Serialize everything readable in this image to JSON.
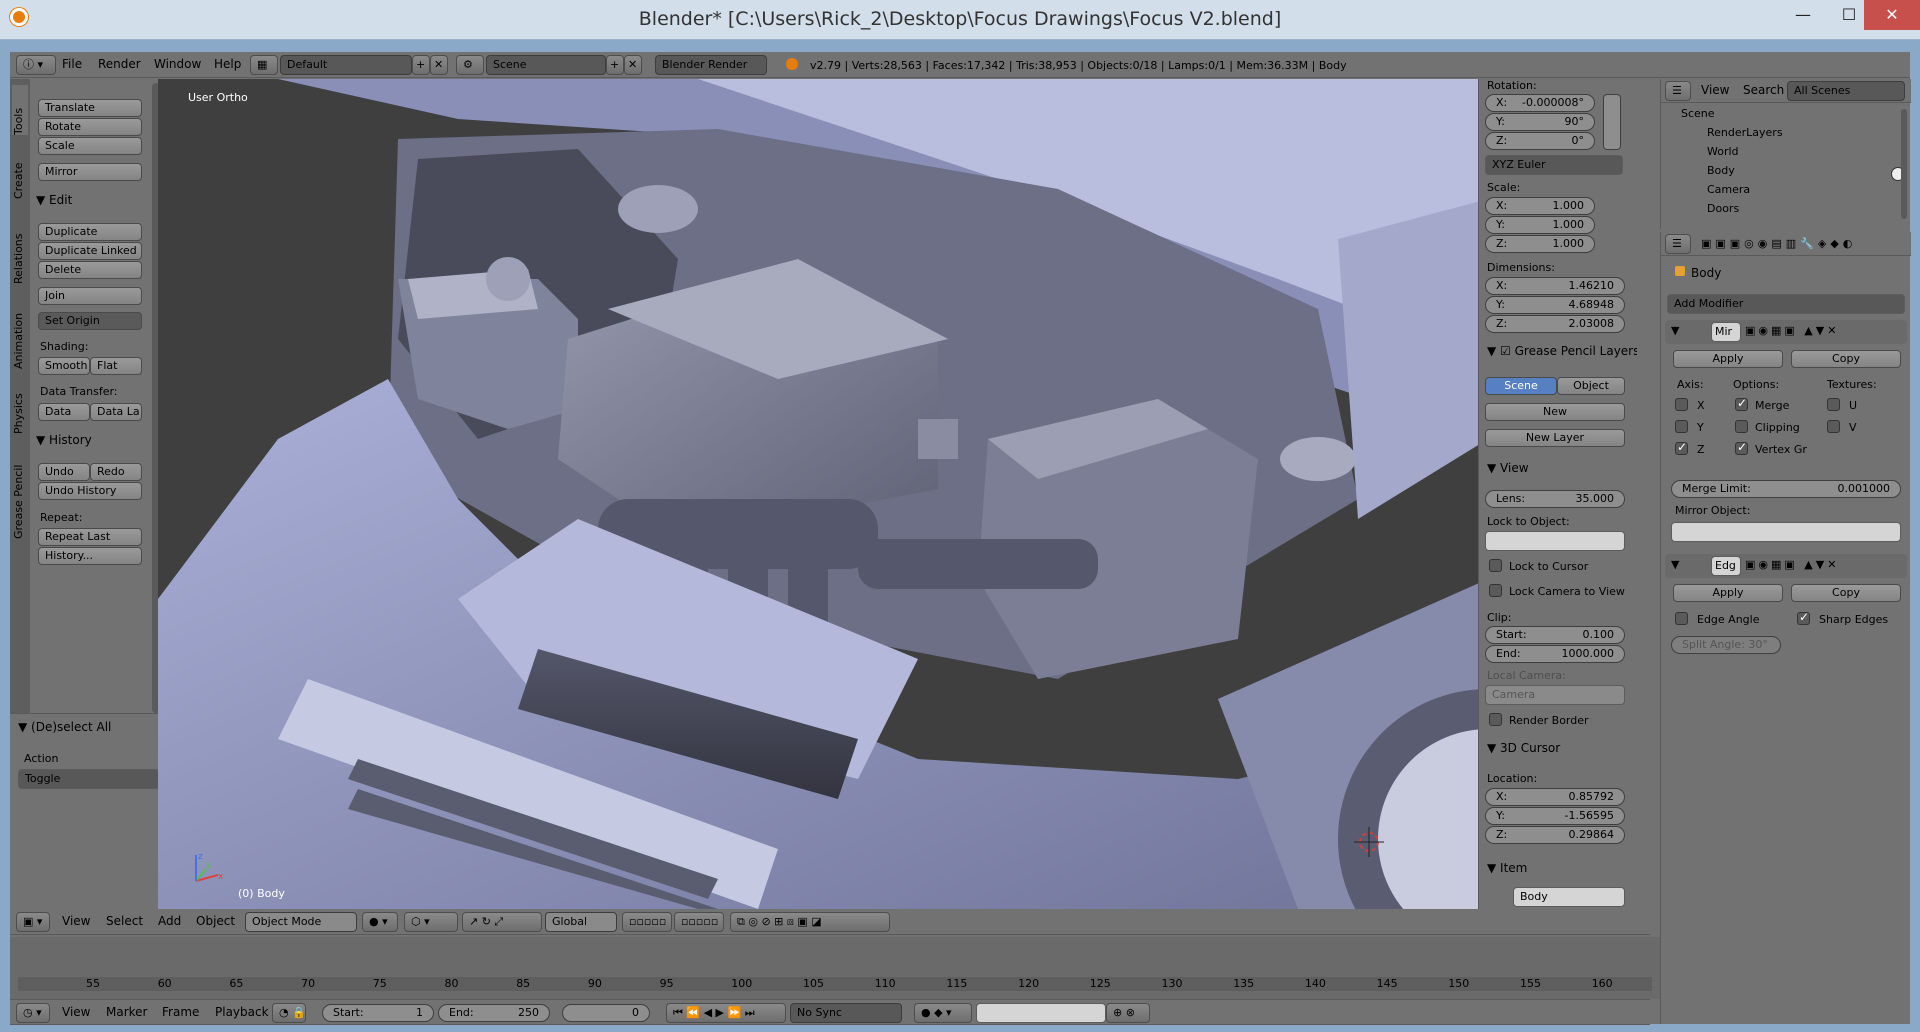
{
  "window": {
    "title": "Blender* [C:\\Users\\Rick_2\\Desktop\\Focus Drawings\\Focus V2.blend]",
    "min": "—",
    "max": "☐",
    "close": "✕"
  },
  "info_header": {
    "menus": [
      "File",
      "Render",
      "Window",
      "Help"
    ],
    "screen": "Default",
    "scene": "Scene",
    "engine": "Blender Render",
    "stats": "v2.79 | Verts:28,563 | Faces:17,342 | Tris:38,953 | Objects:0/18 | Lamps:0/1 | Mem:36.33M | Body"
  },
  "tool_tabs": [
    "Tools",
    "Create",
    "Relations",
    "Animation",
    "Physics",
    "Grease Pencil"
  ],
  "tools": {
    "translate": "Translate",
    "rotate": "Rotate",
    "scale": "Scale",
    "mirror": "Mirror",
    "edit_header": "Edit",
    "duplicate": "Duplicate",
    "duplicate_linked": "Duplicate Linked",
    "delete": "Delete",
    "join": "Join",
    "set_origin": "Set Origin",
    "shading_label": "Shading:",
    "smooth": "Smooth",
    "flat": "Flat",
    "data_transfer_label": "Data Transfer:",
    "data": "Data",
    "data_la": "Data La",
    "history_header": "History",
    "undo": "Undo",
    "redo": "Redo",
    "undo_history": "Undo History",
    "repeat_label": "Repeat:",
    "repeat_last": "Repeat Last",
    "history": "History..."
  },
  "operator": {
    "header": "(De)select All",
    "action_label": "Action",
    "action_value": "Toggle"
  },
  "viewport": {
    "view_label": "User Ortho",
    "object_label": "(0) Body"
  },
  "view3d_header": {
    "menus": [
      "View",
      "Select",
      "Add",
      "Object"
    ],
    "mode": "Object Mode",
    "orientation": "Global"
  },
  "properties_panel": {
    "rotation_label": "Rotation:",
    "rot_x": "-0.000008°",
    "rot_y": "90°",
    "rot_z": "0°",
    "rot_mode": "XYZ Euler",
    "scale_label": "Scale:",
    "scale_x": "1.000",
    "scale_y": "1.000",
    "scale_z": "1.000",
    "dimensions_label": "Dimensions:",
    "dim_x": "1.46210",
    "dim_y": "4.68948",
    "dim_z": "2.03008",
    "gp_header": "Grease Pencil Layers",
    "gp_scene": "Scene",
    "gp_object": "Object",
    "gp_new": "New",
    "gp_new_layer": "New Layer",
    "view_header": "View",
    "lens_label": "Lens:",
    "lens_value": "35.000",
    "lock_to_object": "Lock to Object:",
    "lock_to_cursor": "Lock to Cursor",
    "lock_camera": "Lock Camera to View",
    "clip_label": "Clip:",
    "clip_start_label": "Start:",
    "clip_start": "0.100",
    "clip_end_label": "End:",
    "clip_end": "1000.000",
    "local_camera": "Local Camera:",
    "camera": "Camera",
    "render_border": "Render Border",
    "cursor_header": "3D Cursor",
    "location_label": "Location:",
    "loc_x": "0.85792",
    "loc_y": "-1.56595",
    "loc_z": "0.29864",
    "item_header": "Item",
    "item_name": "Body"
  },
  "outliner": {
    "menus": [
      "View",
      "Search"
    ],
    "filter": "All Scenes",
    "items": [
      "Scene",
      "RenderLayers",
      "World",
      "Body",
      "Camera",
      "Doors"
    ]
  },
  "modifiers": {
    "object": "Body",
    "add_modifier": "Add Modifier",
    "mod1": {
      "name": "Mir",
      "apply": "Apply",
      "copy": "Copy",
      "axis_label": "Axis:",
      "options_label": "Options:",
      "textures_label": "Textures:",
      "x": "X",
      "y": "Y",
      "z": "Z",
      "merge": "Merge",
      "clipping": "Clipping",
      "vertex_gr": "Vertex Gr",
      "u": "U",
      "v": "V",
      "merge_limit_label": "Merge Limit:",
      "merge_limit": "0.001000",
      "mirror_object": "Mirror Object:"
    },
    "mod2": {
      "name": "Edg",
      "apply": "Apply",
      "copy": "Copy",
      "edge_angle": "Edge Angle",
      "sharp_edges": "Sharp Edges",
      "split_angle": "Split Angle: 30°"
    }
  },
  "timeline": {
    "ticks": [
      "55",
      "60",
      "65",
      "70",
      "75",
      "80",
      "85",
      "90",
      "95",
      "100",
      "105",
      "110",
      "115",
      "120",
      "125",
      "130",
      "135",
      "140",
      "145",
      "150",
      "155",
      "160"
    ],
    "menus": [
      "View",
      "Marker",
      "Frame",
      "Playback"
    ],
    "start_label": "Start:",
    "start": "1",
    "end_label": "End:",
    "end": "250",
    "current": "0",
    "sync": "No Sync"
  },
  "axes": {
    "x": "x",
    "y": "y",
    "z": "z"
  }
}
